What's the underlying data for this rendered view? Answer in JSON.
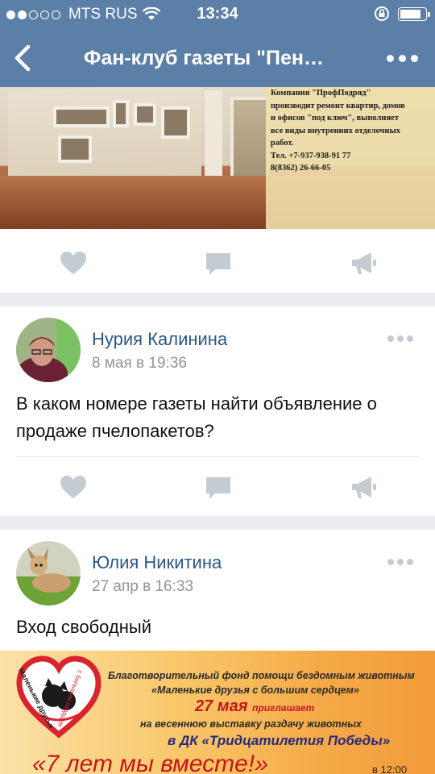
{
  "status_bar": {
    "carrier": "MTS RUS",
    "time": "13:34",
    "signal_bars": 2,
    "battery_level": 0.85
  },
  "nav": {
    "title": "Фан-клуб газеты \"Пен…",
    "back_icon": "chevron-left-icon",
    "more_icon": "more-horizontal-icon"
  },
  "posts": [
    {
      "ad_text": [
        "Компания \"ПрофПодряд\"",
        "производит ремонт квартир, домов",
        "и офисов \"под ключ\", выполняет",
        "все виды внутренних отделочных",
        "работ.",
        "Тел. +7-937-938-91 77",
        "8(8362) 26-66-05"
      ]
    },
    {
      "author": "Нурия Калинина",
      "date": "8 мая в 19:36",
      "text": "В каком номере газеты найти объявление о продаже пчелопакетов?"
    },
    {
      "author": "Юлия Никитина",
      "date": "27 апр в 16:33",
      "text": "Вход свободный",
      "banner": {
        "line1": "Благотворительный фонд помощи бездомным животным",
        "line2": "«Маленькие друзья с большим сердцем»",
        "date": "27 мая",
        "date_suffix": "приглашает",
        "line4": "на весеннюю выставку раздачу животных",
        "line5": "в ДК «Тридцатилетия Победы»",
        "slogan": "«7 лет мы вместе!»",
        "time": "в 12:00",
        "logo_text_left": "Маленькие друзья",
        "logo_text_right": "с большим сердцем"
      }
    }
  ],
  "colors": {
    "header": "#5b7fa6",
    "link": "#2b5788",
    "icon": "#c5cbd2",
    "background": "#ebedf0"
  },
  "icons": {
    "like": "heart-icon",
    "comment": "comment-icon",
    "share": "megaphone-icon"
  }
}
